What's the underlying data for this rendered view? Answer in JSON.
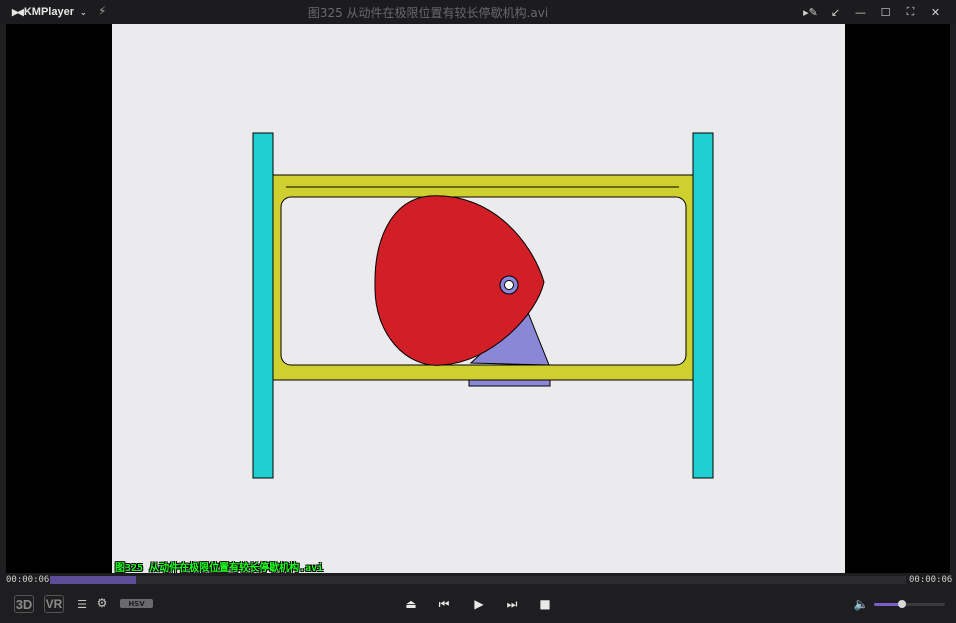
{
  "app": {
    "name": "KMPlayer",
    "window_title": "图325 从动件在极限位置有较长停歇机构.avi"
  },
  "player": {
    "subtitle_overlay": "图325 从动件在极限位置有较长停歇机构.avi",
    "time_current": "00:00:06",
    "time_total": "00:00:06",
    "progress": 0.1,
    "volume": 0.4,
    "badge_3d": "3D",
    "badge_vr": "VR",
    "codec_label": "HSV"
  },
  "colors": {
    "accent": "#5d4d96",
    "frame_yellow": "#cfd030",
    "post_cyan": "#1fcfd2",
    "cam_red": "#d21e26",
    "follower_blue": "#8a87d6",
    "canvas_bg": "#ebebed"
  },
  "icons": {
    "logo": "kmplayer-logo",
    "bolt": "lightning-icon",
    "pin": "pin-icon",
    "restore": "restore-icon",
    "minimize": "minimize-icon",
    "maximize": "maximize-icon",
    "fullscreen": "fullscreen-icon",
    "close": "close-icon",
    "eject": "eject-icon",
    "prev": "skip-previous-icon",
    "play": "play-icon",
    "next": "skip-next-icon",
    "stop": "stop-icon",
    "volume": "volume-icon"
  }
}
